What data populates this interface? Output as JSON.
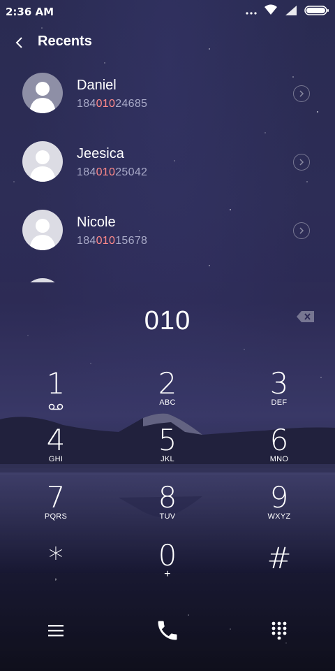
{
  "status_bar": {
    "time": "2:36 AM",
    "icons": [
      "more-dots-icon",
      "wifi-icon",
      "signal-icon",
      "battery-icon"
    ]
  },
  "header": {
    "back_icon": "chevron-left-icon",
    "title": "Recents"
  },
  "recents": [
    {
      "name": "Daniel",
      "number_prefix": "184",
      "number_match": "010",
      "number_suffix": "24685"
    },
    {
      "name": "Jeesica",
      "number_prefix": "184",
      "number_match": "010",
      "number_suffix": "25042"
    },
    {
      "name": "Nicole",
      "number_prefix": "184",
      "number_match": "010",
      "number_suffix": "15678"
    }
  ],
  "dialpad": {
    "dialed": "010",
    "keys": [
      {
        "digit": "1",
        "letters": ""
      },
      {
        "digit": "2",
        "letters": "ABC"
      },
      {
        "digit": "3",
        "letters": "DEF"
      },
      {
        "digit": "4",
        "letters": "GHI"
      },
      {
        "digit": "5",
        "letters": "JKL"
      },
      {
        "digit": "6",
        "letters": "MNO"
      },
      {
        "digit": "7",
        "letters": "PQRS"
      },
      {
        "digit": "8",
        "letters": "TUV"
      },
      {
        "digit": "9",
        "letters": "WXYZ"
      },
      {
        "digit": "*",
        "letters": ","
      },
      {
        "digit": "0",
        "letters": "+"
      },
      {
        "digit": "#",
        "letters": ""
      }
    ]
  },
  "bottom_bar": {
    "icons": [
      "menu-icon",
      "call-icon",
      "dialpad-toggle-icon"
    ]
  },
  "colors": {
    "highlight": "#ff8a8a",
    "secondary_text": "#a9aac8"
  }
}
